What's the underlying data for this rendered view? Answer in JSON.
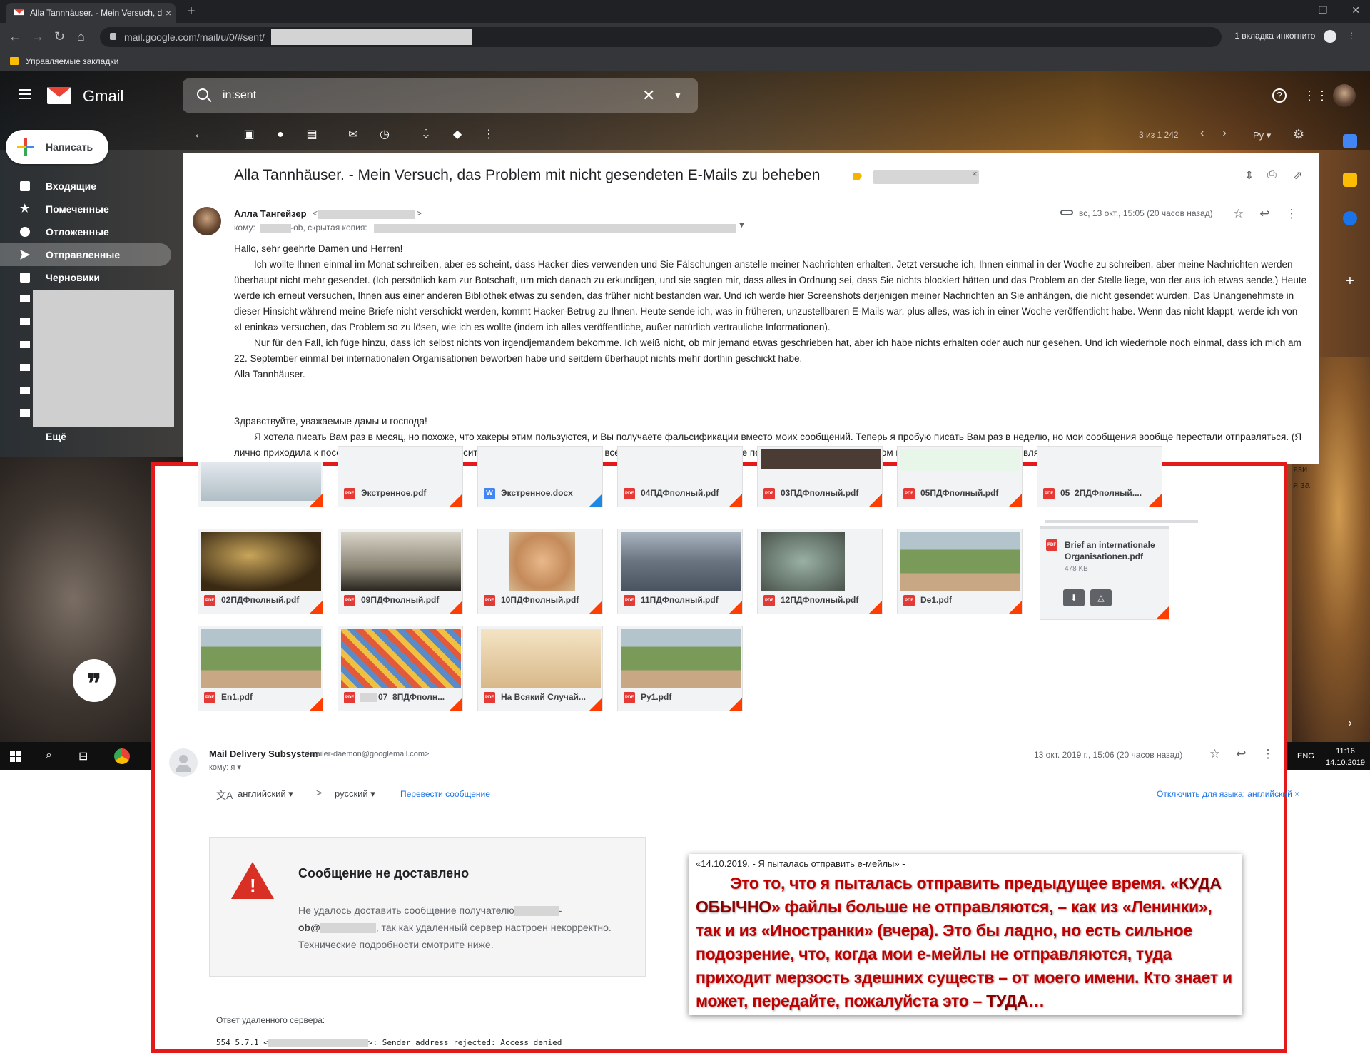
{
  "browser": {
    "tab_title": "Alla Tannhäuser. - Mein Versuch, d",
    "tab_close": "×",
    "new_tab": "+",
    "url_prefix": "mail.google.com/mail/u/0/#sent/",
    "incognito_label": "1 вкладка инкогнито",
    "bookmarks_folder": "Управляемые закладки",
    "window_controls": [
      "–",
      "❐",
      "✕"
    ]
  },
  "gmail": {
    "product_name": "Gmail",
    "search_value": "in:sent",
    "compose_label": "Написать",
    "nav": [
      {
        "label": "Входящие",
        "icon": "inbox-icon"
      },
      {
        "label": "Помеченные",
        "icon": "star-icon"
      },
      {
        "label": "Отложенные",
        "icon": "clock-icon"
      },
      {
        "label": "Отправленные",
        "icon": "send-icon",
        "active": true
      },
      {
        "label": "Черновики",
        "icon": "draft-icon"
      }
    ],
    "nav_more": "Ещё",
    "pager_text": "3 из 1 242",
    "lang_button": "Ру"
  },
  "message": {
    "subject": "Alla Tannhäuser. - Mein Versuch, das Problem mit nicht gesendeten E-Mails zu beheben",
    "sender_name": "Алла Тангейзер",
    "to_prefix": "кому:",
    "to_mid": "-ob, скрытая копия:",
    "date": "вс, 13 окт., 15:05 (20 часов назад)",
    "body": {
      "greeting_de": "Hallo, sehr geehrte Damen und Herren!",
      "p1_de": "Ich wollte Ihnen einmal im Monat schreiben, aber es scheint, dass Hacker dies verwenden und Sie Fälschungen anstelle meiner Nachrichten erhalten. Jetzt versuche ich, Ihnen einmal in der Woche zu schreiben, aber meine Nachrichten werden überhaupt nicht mehr gesendet. (Ich persönlich kam zur Botschaft, um mich danach zu erkundigen, und sie sagten mir, dass alles in Ordnung sei, dass Sie nichts blockiert hätten und das Problem an der Stelle liege, von der aus ich etwas sende.) Heute werde ich erneut versuchen, Ihnen aus einer anderen Bibliothek etwas zu senden, das früher nicht bestanden war. Und ich werde hier Screenshots derjenigen meiner Nachrichten an Sie anhängen, die nicht gesendet wurden. Das Unangenehmste in dieser Hinsicht während meine Briefe nicht verschickt werden, kommt Hacker-Betrug zu Ihnen. Heute sende ich, was in früheren, unzustellbaren E-Mails war, plus alles, was ich in einer Woche veröffentlicht habe. Wenn das nicht klappt, werde ich von «Leninka» versuchen, das Problem so zu lösen, wie ich es wollte (indem ich alles veröffentliche, außer natürlich vertrauliche Informationen).",
      "p2_de": "Nur für den Fall, ich füge hinzu, dass ich selbst nichts von irgendjemandem bekomme. Ich weiß nicht, ob mir jemand etwas geschrieben hat, aber ich habe nichts erhalten oder auch nur gesehen. Und ich wiederhole noch einmal, dass ich mich am 22. September einmal bei internationalen Organisationen beworben habe und seitdem überhaupt nichts mehr dorthin geschickt habe.",
      "sign_de": "Alla Tannhäuser.",
      "greeting_ru": "Здравствуйте, уважаемые дамы и господа!",
      "p1_ru": "Я хотела писать Вам раз в месяц, но похоже, что хакеры этим пользуются, и Вы получаете фальсификации вместо моих сообщений. Теперь я пробую писать Вам раз в неделю, но мои сообщения вообще перестали отправляться. (Я лично приходила к посольству, чтобы об этом спросить, и мне ответили, что у вас всё в порядке, что вы ничего не перекрывали, и проблема в том месте, откуда я что-то отправляю.) Сегодня я"
    },
    "fragment_right_1": "язи",
    "fragment_right_2": "я за"
  },
  "attachments": [
    {
      "name": "",
      "type": "pdf"
    },
    {
      "name": "Экстренное.pdf",
      "type": "pdf"
    },
    {
      "name": "Экстренное.docx",
      "type": "doc"
    },
    {
      "name": "04ПДФполный.pdf",
      "type": "pdf"
    },
    {
      "name": "03ПДФполный.pdf",
      "type": "pdf"
    },
    {
      "name": "05ПДФполный.pdf",
      "type": "pdf"
    },
    {
      "name": "05_2ПДФполный....",
      "type": "pdf"
    },
    {
      "name": "02ПДФполный.pdf",
      "type": "pdf"
    },
    {
      "name": "09ПДФполный.pdf",
      "type": "pdf"
    },
    {
      "name": "10ПДФполный.pdf",
      "type": "pdf"
    },
    {
      "name": "11ПДФполный.pdf",
      "type": "pdf"
    },
    {
      "name": "12ПДФполный.pdf",
      "type": "pdf"
    },
    {
      "name": "De1.pdf",
      "type": "pdf"
    },
    {
      "name": "En1.pdf",
      "type": "pdf"
    },
    {
      "name": "07_8ПДФполн...",
      "type": "pdf"
    },
    {
      "name": "На Всякий Случай...",
      "type": "pdf"
    },
    {
      "name": "Ру1.pdf",
      "type": "pdf"
    }
  ],
  "brief": {
    "name": "Brief an internationale Organisationen.pdf",
    "size": "478 KB",
    "download": "⬇",
    "drive": "△"
  },
  "bounce": {
    "sender_name": "Mail Delivery Subsystem",
    "sender_email": "<mailer-daemon@googlemail.com>",
    "to": "кому: я ▾",
    "date": "13 окт. 2019 г., 15:06 (20 часов назад)",
    "translate_from": "английский ▾",
    "translate_arrow": ">",
    "translate_to": "русский ▾",
    "translate_link": "Перевести сообщение",
    "translate_off": "Отключить для языка: английский ×",
    "title": "Сообщение не доставлено",
    "text_1": "Не удалось доставить сообщение получателю",
    "text_dash": "-",
    "text_ob": "ob@",
    "text_2": ", так как удаленный сервер настроен некорректно. Технические подробности смотрите ниже.",
    "remote_label": "Ответ удаленного сервера:",
    "remote_code_1": "554 5.7.1 <",
    "remote_code_2": ">: Sender address rejected: Access denied"
  },
  "note": {
    "date_line": "«14.10.2019. - Я пыталась отправить е-мейлы» -",
    "text_1": "Это то, что я пыталась отправить предыдущее время. «",
    "text_bold": "КУДА ОБЫЧНО",
    "text_2": "» файлы больше не отправляются, – как из «Ленинки», так и из «Иностранки» (вчера). Это бы ладно, но есть сильное подозрение, что, когда мои е-мейлы не отправляются, туда приходит мерзость здешних существ – от моего имени. Кто знает и может, передайте, пожалуйста это – ",
    "text_bold_2": "ТУДА",
    "text_3": "…"
  },
  "taskbar": {
    "lang": "ENG",
    "time": "11:16",
    "date": "14.10.2019"
  },
  "colors": {
    "overlay_border": "#e41a1a",
    "note_text": "#c00000",
    "link": "#1a73e8",
    "warning": "#d93025"
  }
}
